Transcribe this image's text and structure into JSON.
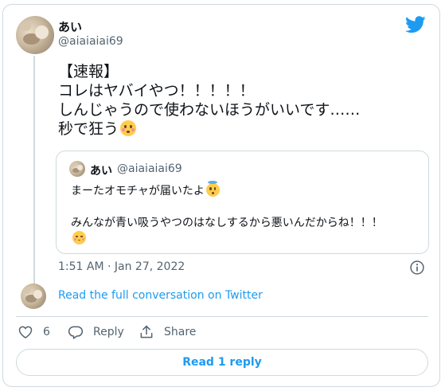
{
  "author": {
    "display_name": "あい",
    "handle": "@aiaiaiai69"
  },
  "tweet": {
    "lines": [
      "【速報】",
      "コレはヤバイやつ！！！！！",
      "しんじゃうので使わないほうがいいです……",
      "秒で狂う"
    ],
    "emoji": "flushed-face",
    "timestamp": "1:51 AM · Jan 27, 2022"
  },
  "quoted": {
    "display_name": "あい",
    "handle": "@aiaiaiai69",
    "line1": "まーたオモチャが届いたよ",
    "line1_emoji": "smiling-face-with-halo",
    "line2": "みんなが青い吸うやつのはなしするから悪いんだからね！！！",
    "line2_emoji": "relieved-face"
  },
  "conversation_link": "Read the full conversation on Twitter",
  "actions": {
    "like_count": "6",
    "reply_label": "Reply",
    "share_label": "Share"
  },
  "read_reply_label": "Read 1 reply",
  "colors": {
    "accent": "#1d9bf0",
    "border": "#cfd9de",
    "secondary_text": "#536471"
  }
}
